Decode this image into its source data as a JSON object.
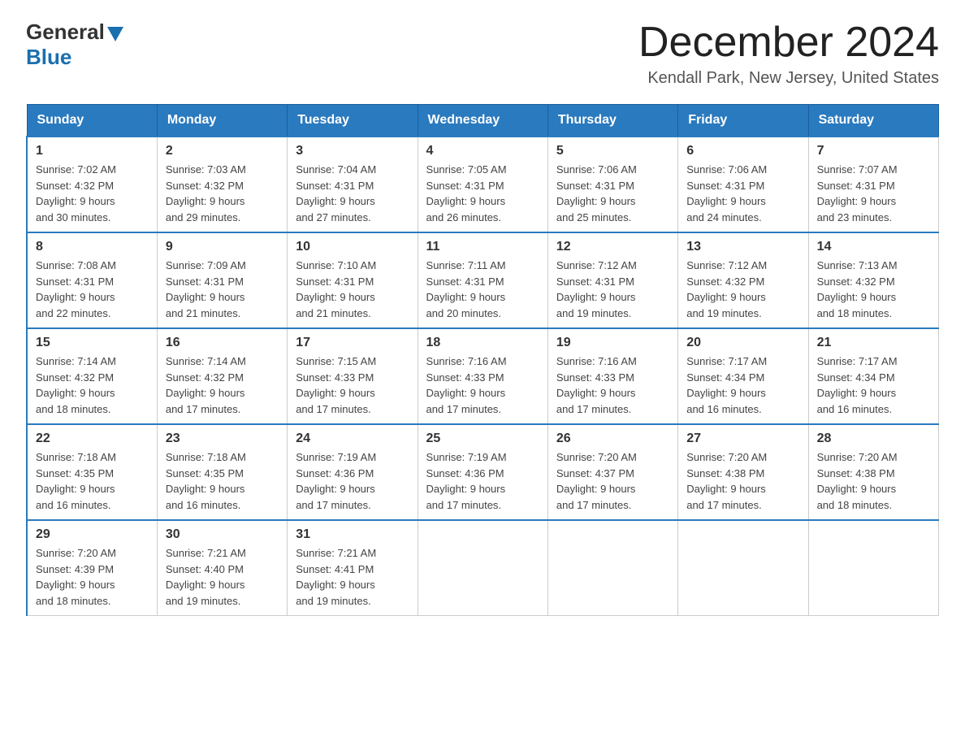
{
  "header": {
    "logo": {
      "general": "General",
      "blue": "Blue"
    },
    "title": "December 2024",
    "location": "Kendall Park, New Jersey, United States"
  },
  "calendar": {
    "days_of_week": [
      "Sunday",
      "Monday",
      "Tuesday",
      "Wednesday",
      "Thursday",
      "Friday",
      "Saturday"
    ],
    "weeks": [
      [
        {
          "day": "1",
          "sunrise": "7:02 AM",
          "sunset": "4:32 PM",
          "daylight": "9 hours and 30 minutes."
        },
        {
          "day": "2",
          "sunrise": "7:03 AM",
          "sunset": "4:32 PM",
          "daylight": "9 hours and 29 minutes."
        },
        {
          "day": "3",
          "sunrise": "7:04 AM",
          "sunset": "4:31 PM",
          "daylight": "9 hours and 27 minutes."
        },
        {
          "day": "4",
          "sunrise": "7:05 AM",
          "sunset": "4:31 PM",
          "daylight": "9 hours and 26 minutes."
        },
        {
          "day": "5",
          "sunrise": "7:06 AM",
          "sunset": "4:31 PM",
          "daylight": "9 hours and 25 minutes."
        },
        {
          "day": "6",
          "sunrise": "7:06 AM",
          "sunset": "4:31 PM",
          "daylight": "9 hours and 24 minutes."
        },
        {
          "day": "7",
          "sunrise": "7:07 AM",
          "sunset": "4:31 PM",
          "daylight": "9 hours and 23 minutes."
        }
      ],
      [
        {
          "day": "8",
          "sunrise": "7:08 AM",
          "sunset": "4:31 PM",
          "daylight": "9 hours and 22 minutes."
        },
        {
          "day": "9",
          "sunrise": "7:09 AM",
          "sunset": "4:31 PM",
          "daylight": "9 hours and 21 minutes."
        },
        {
          "day": "10",
          "sunrise": "7:10 AM",
          "sunset": "4:31 PM",
          "daylight": "9 hours and 21 minutes."
        },
        {
          "day": "11",
          "sunrise": "7:11 AM",
          "sunset": "4:31 PM",
          "daylight": "9 hours and 20 minutes."
        },
        {
          "day": "12",
          "sunrise": "7:12 AM",
          "sunset": "4:31 PM",
          "daylight": "9 hours and 19 minutes."
        },
        {
          "day": "13",
          "sunrise": "7:12 AM",
          "sunset": "4:32 PM",
          "daylight": "9 hours and 19 minutes."
        },
        {
          "day": "14",
          "sunrise": "7:13 AM",
          "sunset": "4:32 PM",
          "daylight": "9 hours and 18 minutes."
        }
      ],
      [
        {
          "day": "15",
          "sunrise": "7:14 AM",
          "sunset": "4:32 PM",
          "daylight": "9 hours and 18 minutes."
        },
        {
          "day": "16",
          "sunrise": "7:14 AM",
          "sunset": "4:32 PM",
          "daylight": "9 hours and 17 minutes."
        },
        {
          "day": "17",
          "sunrise": "7:15 AM",
          "sunset": "4:33 PM",
          "daylight": "9 hours and 17 minutes."
        },
        {
          "day": "18",
          "sunrise": "7:16 AM",
          "sunset": "4:33 PM",
          "daylight": "9 hours and 17 minutes."
        },
        {
          "day": "19",
          "sunrise": "7:16 AM",
          "sunset": "4:33 PM",
          "daylight": "9 hours and 17 minutes."
        },
        {
          "day": "20",
          "sunrise": "7:17 AM",
          "sunset": "4:34 PM",
          "daylight": "9 hours and 16 minutes."
        },
        {
          "day": "21",
          "sunrise": "7:17 AM",
          "sunset": "4:34 PM",
          "daylight": "9 hours and 16 minutes."
        }
      ],
      [
        {
          "day": "22",
          "sunrise": "7:18 AM",
          "sunset": "4:35 PM",
          "daylight": "9 hours and 16 minutes."
        },
        {
          "day": "23",
          "sunrise": "7:18 AM",
          "sunset": "4:35 PM",
          "daylight": "9 hours and 16 minutes."
        },
        {
          "day": "24",
          "sunrise": "7:19 AM",
          "sunset": "4:36 PM",
          "daylight": "9 hours and 17 minutes."
        },
        {
          "day": "25",
          "sunrise": "7:19 AM",
          "sunset": "4:36 PM",
          "daylight": "9 hours and 17 minutes."
        },
        {
          "day": "26",
          "sunrise": "7:20 AM",
          "sunset": "4:37 PM",
          "daylight": "9 hours and 17 minutes."
        },
        {
          "day": "27",
          "sunrise": "7:20 AM",
          "sunset": "4:38 PM",
          "daylight": "9 hours and 17 minutes."
        },
        {
          "day": "28",
          "sunrise": "7:20 AM",
          "sunset": "4:38 PM",
          "daylight": "9 hours and 18 minutes."
        }
      ],
      [
        {
          "day": "29",
          "sunrise": "7:20 AM",
          "sunset": "4:39 PM",
          "daylight": "9 hours and 18 minutes."
        },
        {
          "day": "30",
          "sunrise": "7:21 AM",
          "sunset": "4:40 PM",
          "daylight": "9 hours and 19 minutes."
        },
        {
          "day": "31",
          "sunrise": "7:21 AM",
          "sunset": "4:41 PM",
          "daylight": "9 hours and 19 minutes."
        },
        null,
        null,
        null,
        null
      ]
    ],
    "labels": {
      "sunrise": "Sunrise: ",
      "sunset": "Sunset: ",
      "daylight": "Daylight: "
    }
  }
}
